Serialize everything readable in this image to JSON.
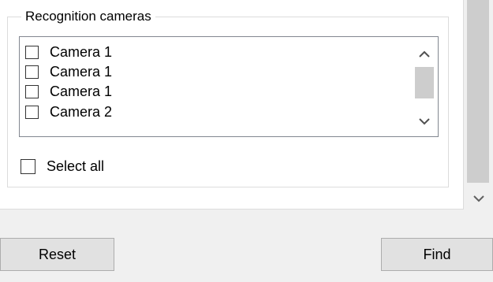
{
  "group_box": {
    "title": "Recognition cameras"
  },
  "camera_list": {
    "items": [
      {
        "label": "Camera 1",
        "checked": false
      },
      {
        "label": "Camera 1",
        "checked": false
      },
      {
        "label": "Camera 1",
        "checked": false
      },
      {
        "label": "Camera 2",
        "checked": false
      }
    ],
    "scroll_up_icon": "chevron-up-icon",
    "scroll_down_icon": "chevron-down-icon"
  },
  "select_all": {
    "label": "Select all",
    "checked": false
  },
  "outer_scrollbar": {
    "down_icon": "chevron-down-icon"
  },
  "buttons": {
    "reset_label": "Reset",
    "find_label": "Find"
  },
  "colors": {
    "panel_background": "#ffffff",
    "window_background": "#f0f0f0",
    "button_face": "#e1e1e1",
    "scroll_thumb": "#cdcdcd",
    "list_border": "#828790"
  }
}
